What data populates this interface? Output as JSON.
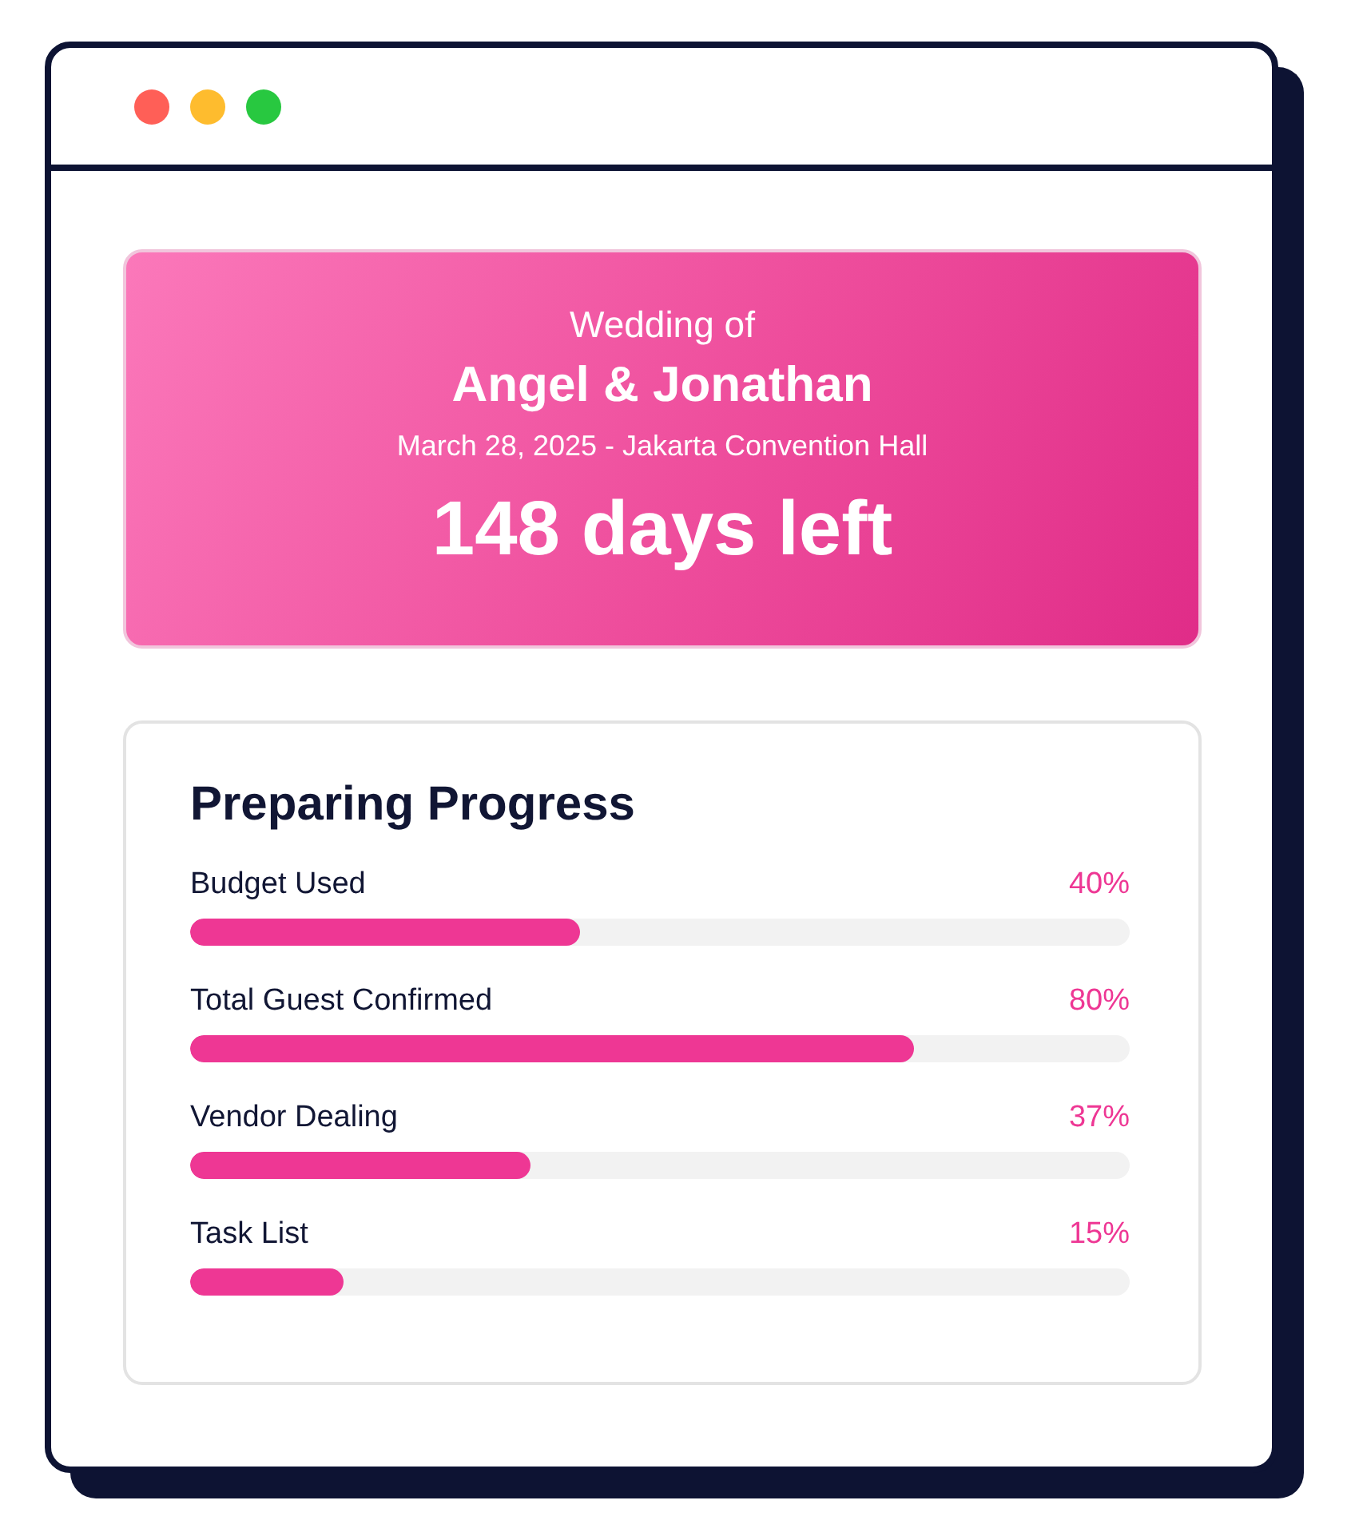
{
  "window": {
    "controls": [
      {
        "color": "#ff5f57"
      },
      {
        "color": "#febc2e"
      },
      {
        "color": "#28c840"
      }
    ]
  },
  "hero": {
    "subtitle": "Wedding of",
    "couple": "Angel & Jonathan",
    "details": "March 28, 2025 - Jakarta Convention Hall",
    "countdown": "148 days left"
  },
  "progress": {
    "title": "Preparing Progress",
    "items": [
      {
        "label": "Budget Used",
        "reading": "40%",
        "level": 0.415
      },
      {
        "label": "Total Guest Confirmed",
        "reading": "80%",
        "level": 0.77
      },
      {
        "label": "Vendor Dealing",
        "reading": "37%",
        "level": 0.363
      },
      {
        "label": "Task List",
        "reading": "15%",
        "level": 0.163
      }
    ]
  }
}
